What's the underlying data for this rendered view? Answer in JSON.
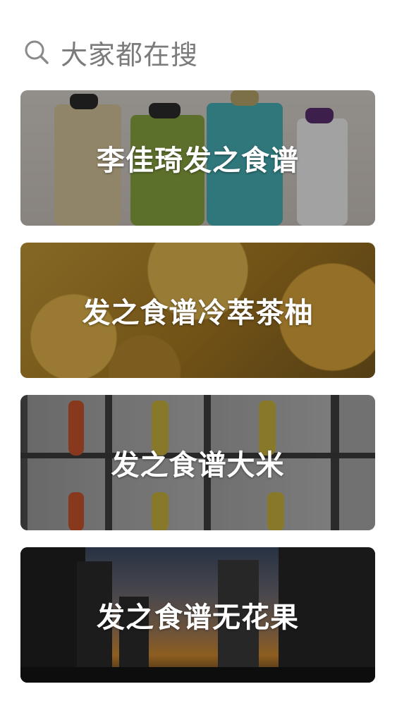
{
  "header": {
    "title": "大家都在搜",
    "icon": "search-icon"
  },
  "cards": [
    {
      "label": "李佳琦发之食谱"
    },
    {
      "label": "发之食谱冷萃茶柚"
    },
    {
      "label": "发之食谱大米"
    },
    {
      "label": "发之食谱无花果"
    }
  ],
  "colors": {
    "background": "#ffffff",
    "header_text": "#7b7b7b",
    "card_text": "#ffffff"
  }
}
